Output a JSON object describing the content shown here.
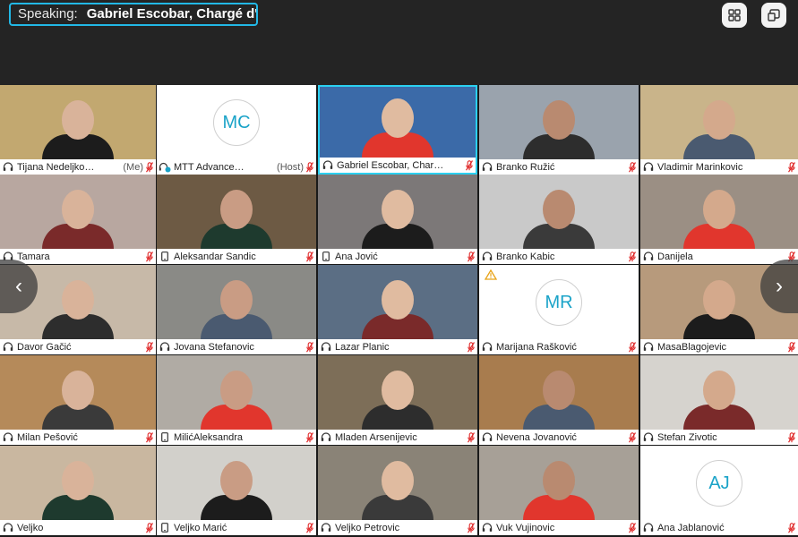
{
  "speaking_banner": {
    "label": "Speaking:",
    "name": "Gabriel Escobar, Chargé d'…"
  },
  "icons": {
    "grid_view": "grid-view-icon",
    "exit_fullscreen": "minimize-window-icon",
    "prev": "chevron-left-icon",
    "next": "chevron-right-icon"
  },
  "colors": {
    "accent": "#2bd0f0",
    "avatar_text": "#1aa3c8",
    "mute": "#e02828"
  },
  "participants": [
    {
      "name": "Tijana Nedeljko…",
      "tag": "(Me)",
      "device": "headphones",
      "bg": "#c2a870"
    },
    {
      "name": "MTT Advance…",
      "tag": "(Host)",
      "device": "computer-audio",
      "avatar": "MC"
    },
    {
      "name": "Gabriel Escobar, Char…",
      "tag": "",
      "device": "headphones",
      "bg": "#3b6aa8",
      "active": true
    },
    {
      "name": "Branko Ružić",
      "tag": "",
      "device": "headphones",
      "bg": "#9aa3ad"
    },
    {
      "name": "Vladimir Marinkovic",
      "tag": "",
      "device": "headphones",
      "bg": "#c9b48a"
    },
    {
      "name": "Tamara",
      "tag": "",
      "device": "headphones",
      "bg": "#b8a7a0"
    },
    {
      "name": "Aleksandar Sandic",
      "tag": "",
      "device": "phone",
      "bg": "#6d5a44"
    },
    {
      "name": "Ana Jović",
      "tag": "",
      "device": "phone",
      "bg": "#7c7878"
    },
    {
      "name": "Branko Kabic",
      "tag": "",
      "device": "headphones",
      "bg": "#c9c9c9"
    },
    {
      "name": "Danijela",
      "tag": "",
      "device": "headphones",
      "bg": "#9b8f84"
    },
    {
      "name": "Davor Gačić",
      "tag": "",
      "device": "headphones",
      "bg": "#c7b9a8"
    },
    {
      "name": "Jovana Stefanovic",
      "tag": "",
      "device": "headphones",
      "bg": "#8a8a86"
    },
    {
      "name": "Lazar Planic",
      "tag": "",
      "device": "headphones",
      "bg": "#5b6e84"
    },
    {
      "name": "Marijana Rašković",
      "tag": "",
      "device": "headphones",
      "avatar": "MR",
      "warning": true
    },
    {
      "name": "MasaBlagojevic",
      "tag": "",
      "device": "headphones",
      "bg": "#b79a7c"
    },
    {
      "name": "Milan Pešović",
      "tag": "",
      "device": "headphones",
      "bg": "#b58a5a"
    },
    {
      "name": "MilićAleksandra",
      "tag": "",
      "device": "phone",
      "bg": "#b0aba4"
    },
    {
      "name": "Mladen Arsenijevic",
      "tag": "",
      "device": "headphones",
      "bg": "#7d6e58"
    },
    {
      "name": "Nevena Jovanović",
      "tag": "",
      "device": "headphones",
      "bg": "#a87c4e"
    },
    {
      "name": "Stefan Zivotic",
      "tag": "",
      "device": "headphones",
      "bg": "#d6d3ce"
    },
    {
      "name": "Veljko",
      "tag": "",
      "device": "headphones",
      "bg": "#c9b7a0"
    },
    {
      "name": "Veljko Marić",
      "tag": "",
      "device": "phone",
      "bg": "#d2d0cb"
    },
    {
      "name": "Veljko Petrovic",
      "tag": "",
      "device": "headphones",
      "bg": "#8a8377"
    },
    {
      "name": "Vuk Vujinovic",
      "tag": "",
      "device": "headphones",
      "bg": "#a7a097"
    },
    {
      "name": "Ana Jablanović",
      "tag": "",
      "device": "headphones",
      "avatar": "AJ"
    }
  ]
}
